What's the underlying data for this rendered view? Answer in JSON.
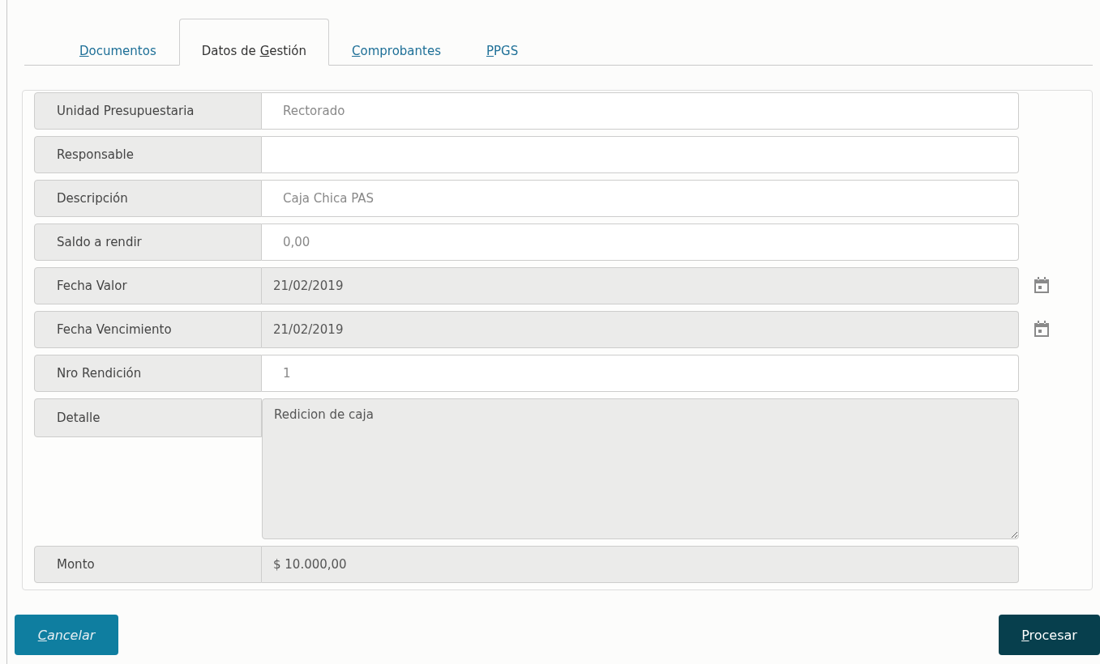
{
  "tabs": [
    {
      "key": "D",
      "after": "ocumentos",
      "selected": false
    },
    {
      "before": "Datos de ",
      "key": "G",
      "after": "estión",
      "selected": true
    },
    {
      "key": "C",
      "after": "omprobantes",
      "selected": false
    },
    {
      "key": "P",
      "after": "PGS",
      "selected": false
    }
  ],
  "fields": [
    {
      "label": "Unidad Presupuestaria",
      "kind": "text",
      "disabled": false,
      "value": "Rectorado"
    },
    {
      "label": "Responsable",
      "kind": "text",
      "disabled": false
    },
    {
      "label": "Descripción",
      "kind": "text",
      "disabled": false,
      "value": "Caja Chica PAS"
    },
    {
      "label": "Saldo a rendir",
      "kind": "text",
      "disabled": false,
      "value": "0,00"
    },
    {
      "label": "Fecha Valor",
      "kind": "date",
      "disabled": true,
      "value": "21/02/2019"
    },
    {
      "label": "Fecha Vencimiento",
      "kind": "date",
      "disabled": true,
      "value": "21/02/2019"
    },
    {
      "label": "Nro Rendición",
      "kind": "text",
      "disabled": false,
      "value": "1"
    },
    {
      "label": "Detalle",
      "kind": "textarea",
      "disabled": true,
      "value": "Redicion de caja"
    },
    {
      "label": "Monto",
      "kind": "text",
      "disabled": true,
      "value": "$ 10.000,00"
    }
  ],
  "buttons": [
    {
      "key": "C",
      "after": "ancelar",
      "kind": "secondary"
    },
    {
      "key": "P",
      "after": "rocesar",
      "kind": "primary"
    }
  ]
}
